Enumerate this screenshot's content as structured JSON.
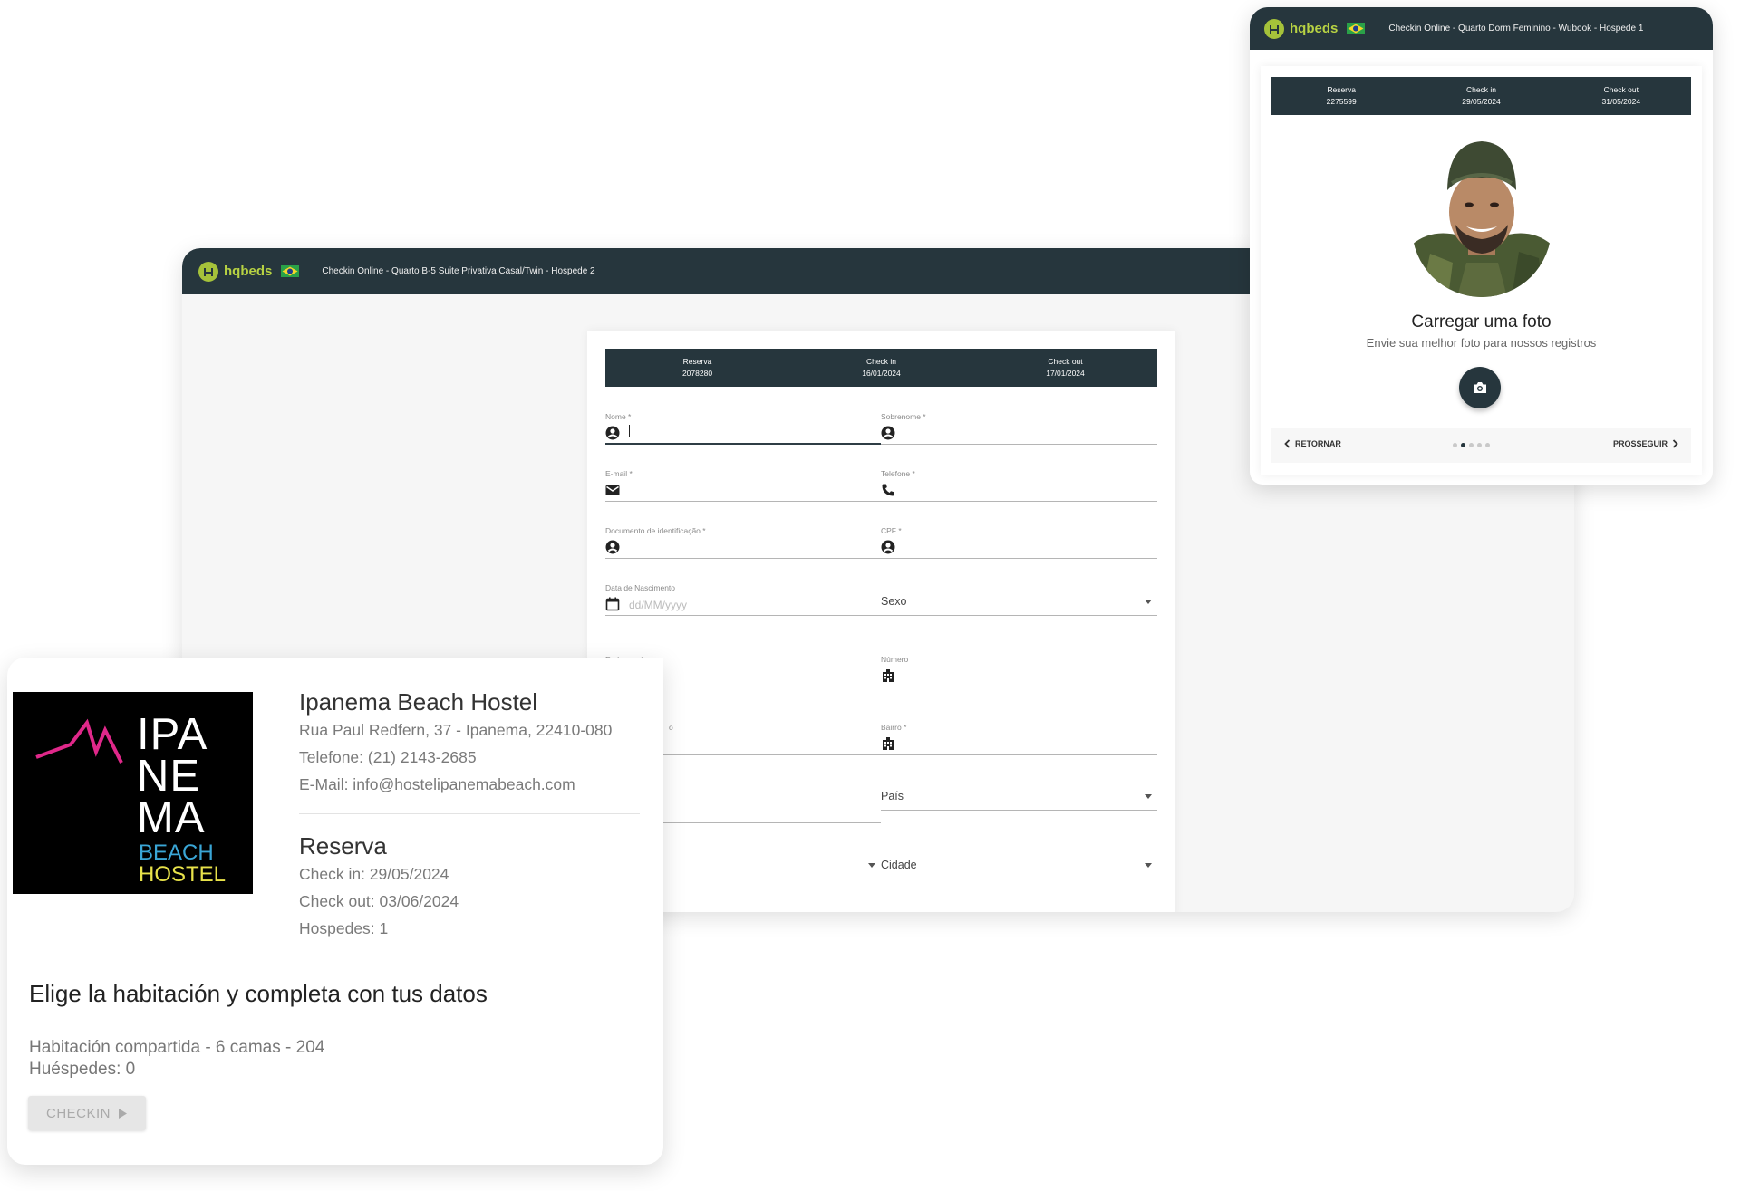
{
  "colors": {
    "header": "#26363d",
    "brand_green": "#b7d243",
    "logo_pink": "#e0288a",
    "logo_blue": "#3aa6d6",
    "logo_yellow": "#e8e24a"
  },
  "main_window": {
    "logo": "hqbeds",
    "title": "Checkin Online - Quarto B-5 Suite Privativa Casal/Twin - Hospede 2",
    "reservation": [
      {
        "label": "Reserva",
        "value": "2078280"
      },
      {
        "label": "Check in",
        "value": "16/01/2024"
      },
      {
        "label": "Check out",
        "value": "17/01/2024"
      }
    ],
    "fields": {
      "nome": "Nome *",
      "sobrenome": "Sobrenome *",
      "email": "E-mail *",
      "telefone": "Telefone *",
      "documento": "Documento de identificação *",
      "cpf": "CPF *",
      "nascimento": "Data de Nascimento",
      "nascimento_placeholder": "dd/MM/yyyy",
      "sexo": "Sexo",
      "endereco": "Endereço *",
      "numero": "Número",
      "complemento_fragment": "o",
      "bairro": "Bairro *",
      "pais": "País",
      "cidade": "Cidade"
    }
  },
  "photo_window": {
    "logo": "hqbeds",
    "title": "Checkin Online - Quarto Dorm Feminino - Wubook - Hospede 1",
    "reservation": [
      {
        "label": "Reserva",
        "value": "2275599"
      },
      {
        "label": "Check in",
        "value": "29/05/2024"
      },
      {
        "label": "Check out",
        "value": "31/05/2024"
      }
    ],
    "photo_title": "Carregar uma foto",
    "photo_subtitle": "Envie sua melhor foto para nossos registros",
    "back_label": "RETORNAR",
    "next_label": "PROSSEGUIR",
    "step": {
      "current": 2,
      "total": 5
    }
  },
  "hostel_card": {
    "logo_lines": [
      "IPA",
      "NE",
      "MA",
      "BEACH",
      "HOSTEL"
    ],
    "name": "Ipanema Beach Hostel",
    "address": "Rua Paul Redfern, 37 - Ipanema, 22410-080",
    "phone": "Telefone: (21) 2143-2685",
    "email": "E-Mail: info@hostelipanemabeach.com",
    "reservation_title": "Reserva",
    "checkin": "Check in: 29/05/2024",
    "checkout": "Check out: 03/06/2024",
    "guests": "Hospedes: 1",
    "choose_title": "Elige la habitación y completa con tus datos",
    "room": "Habitación compartida - 6 camas - 204",
    "room_guests": "Huéspedes: 0",
    "checkin_button": "CHECKIN"
  }
}
